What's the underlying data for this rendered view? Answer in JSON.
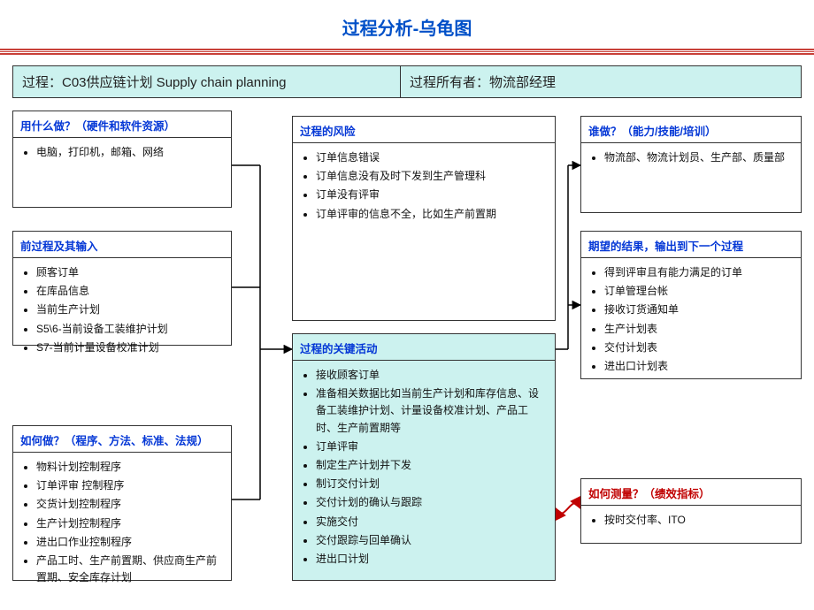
{
  "pageTitle": "过程分析-乌龟图",
  "header": {
    "processLabel": "过程：C03供应链计划   Supply chain planning",
    "ownerLabel": "过程所有者：物流部经理"
  },
  "boxes": {
    "resources": {
      "title": "用什么做？（硬件和软件资源）",
      "items": [
        "电脑，打印机，邮箱、网络"
      ]
    },
    "inputs": {
      "title": "前过程及其输入",
      "items": [
        "顾客订单",
        "在库品信息",
        "当前生产计划",
        "S5\\6-当前设备工装维护计划",
        "S7-当前计量设备校准计划"
      ]
    },
    "how": {
      "title": "如何做？（程序、方法、标准、法规）",
      "items": [
        "物料计划控制程序",
        "订单评审 控制程序",
        "交货计划控制程序",
        "生产计划控制程序",
        "进出口作业控制程序",
        "产品工时、生产前置期、供应商生产前置期、安全库存计划"
      ]
    },
    "risk": {
      "title": "过程的风险",
      "items": [
        "订单信息错误",
        "订单信息没有及时下发到生产管理科",
        "订单没有评审",
        "订单评审的信息不全，比如生产前置期"
      ]
    },
    "key": {
      "title": "过程的关键活动",
      "items": [
        "接收顾客订单",
        "准备相关数据比如当前生产计划和库存信息、设备工装维护计划、计量设备校准计划、产品工时、生产前置期等",
        "订单评审",
        "制定生产计划并下发",
        "制订交付计划",
        "交付计划的确认与跟踪",
        "实施交付",
        "交付跟踪与回单确认",
        "进出口计划"
      ]
    },
    "who": {
      "title": "谁做？（能力/技能/培训）",
      "items": [
        "物流部、物流计划员、生产部、质量部"
      ]
    },
    "output": {
      "title": "期望的结果，输出到下一个过程",
      "items": [
        "得到评审且有能力满足的订单",
        "订单管理台帐",
        "接收订货通知单",
        "生产计划表",
        "交付计划表",
        "进出口计划表"
      ]
    },
    "measure": {
      "title": "如何测量？（绩效指标）",
      "items": [
        "按时交付率、ITO"
      ]
    }
  }
}
